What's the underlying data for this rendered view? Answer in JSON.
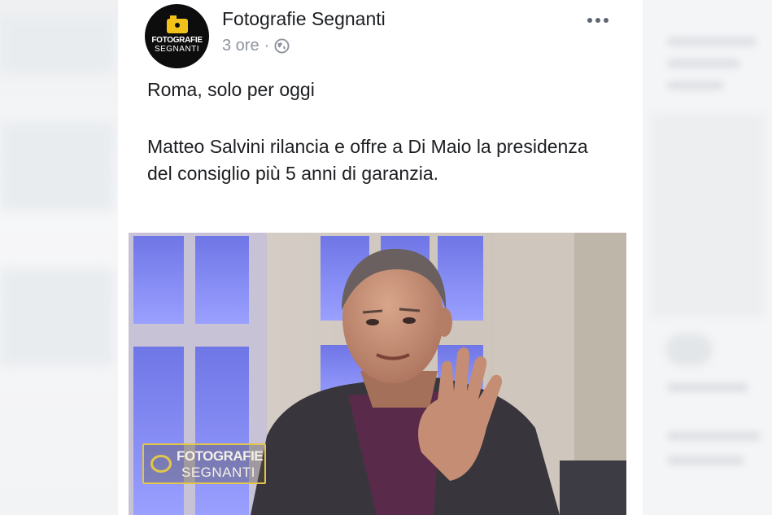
{
  "post": {
    "page_name": "Fotografie Segnanti",
    "timestamp": "3 ore",
    "separator": "·",
    "visibility_icon": "globe-icon",
    "more_icon": "more-options-icon",
    "avatar": {
      "logo_line1": "FOTOGRAFIE",
      "logo_line2": "SEGNANTI",
      "accent": "#f2c21b"
    },
    "text_line1": "Roma, solo per oggi",
    "text_line2": "Matteo Salvini rilancia e offre a Di Maio la presidenza del consiglio più 5 anni di garanzia."
  },
  "media": {
    "watermark_line1": "FOTOGRAFIE",
    "watermark_line2": "SEGNANTI",
    "watermark_color": "#e2c64a"
  }
}
